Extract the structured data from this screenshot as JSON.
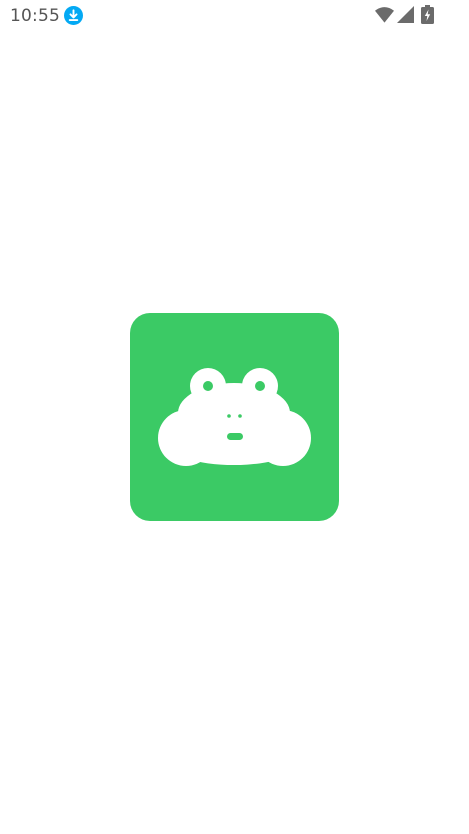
{
  "status_bar": {
    "time": "10:55",
    "icons": [
      "download-icon",
      "wifi-icon",
      "signal-icon",
      "battery-charging-icon"
    ]
  },
  "splash": {
    "logo_icon": "frog-cloud-icon"
  },
  "colors": {
    "brand_green": "#3BCA65",
    "download_blue": "#03A9F4",
    "status_icon_gray": "#6B6B6B",
    "background": "#FFFFFF"
  }
}
